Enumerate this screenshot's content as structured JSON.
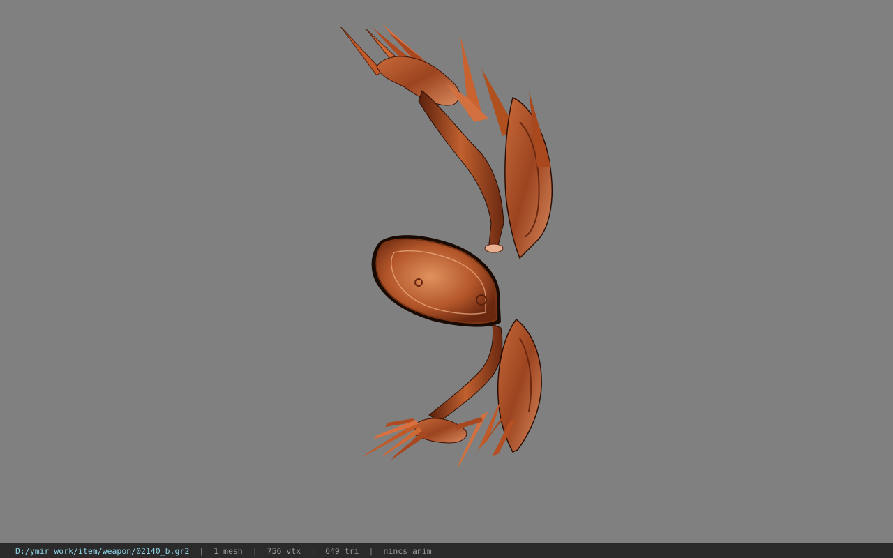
{
  "viewer": {
    "background_color": "#808080",
    "model_icon": "claw-weapon-model",
    "model_colors": {
      "base": "#b5532a",
      "highlight": "#e08a5a",
      "dark": "#5a200c",
      "rim": "#1a0a04"
    }
  },
  "statusbar": {
    "file_path": "D:/ymir work/item/weapon/02140_b.gr2",
    "separator": "|",
    "mesh_count": "1 mesh",
    "vertex_count": "756 vtx",
    "triangle_count": "649 tri",
    "animation": "nincs anim"
  }
}
